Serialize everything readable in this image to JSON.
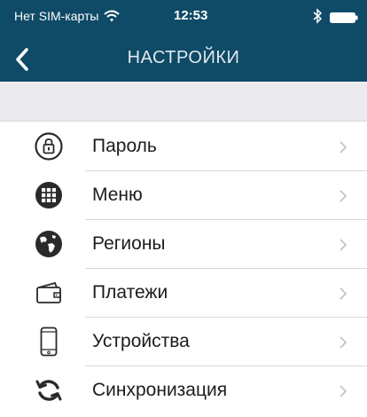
{
  "status_bar": {
    "carrier": "Нет SIM-карты",
    "wifi_icon": "wifi-icon",
    "time": "12:53",
    "bluetooth_icon": "bluetooth-icon",
    "battery_icon": "battery-icon"
  },
  "header": {
    "title": "НАСТРОЙКИ",
    "back_icon": "chevron-left-icon",
    "background": "#0f4a66"
  },
  "settings": {
    "items": [
      {
        "label": "Пароль",
        "icon": "lock-icon"
      },
      {
        "label": "Меню",
        "icon": "grid-icon"
      },
      {
        "label": "Регионы",
        "icon": "globe-icon"
      },
      {
        "label": "Платежи",
        "icon": "wallet-icon"
      },
      {
        "label": "Устройства",
        "icon": "phone-icon"
      },
      {
        "label": "Синхронизация",
        "icon": "sync-icon"
      }
    ]
  }
}
